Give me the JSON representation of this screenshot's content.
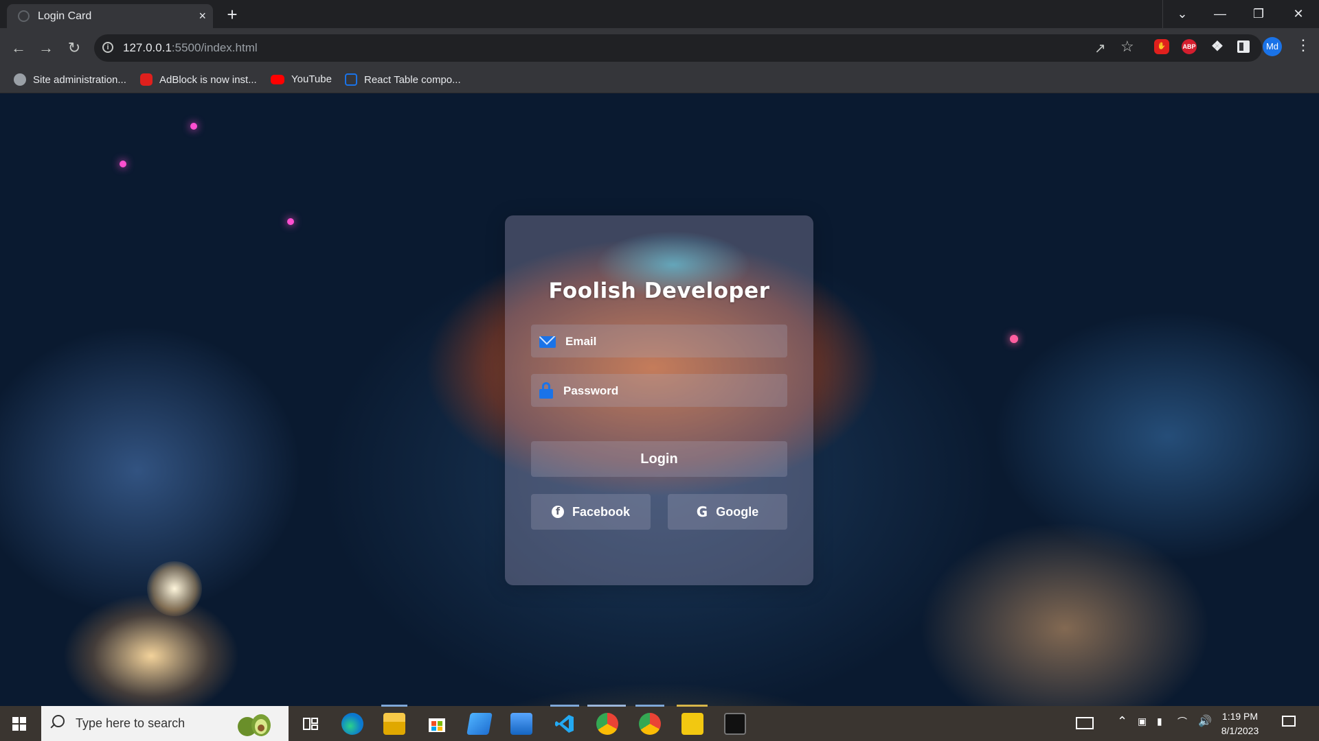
{
  "browser": {
    "tab_title": "Login Card",
    "tab_close": "×",
    "new_tab": "+",
    "url_host": "127.0.0.1",
    "url_rest": ":5500/index.html",
    "profile_initials": "Md",
    "extension_abp": "ABP",
    "bookmarks": [
      {
        "label": "Site administration..."
      },
      {
        "label": "AdBlock is now inst..."
      },
      {
        "label": "YouTube"
      },
      {
        "label": "React Table compo..."
      }
    ]
  },
  "login_card": {
    "title": "Foolish Developer",
    "email_placeholder": "Email",
    "password_placeholder": "Password",
    "login_label": "Login",
    "facebook_label": "Facebook",
    "google_label": "Google"
  },
  "taskbar": {
    "search_placeholder": "Type here to search",
    "time": "1:19 PM",
    "date": "8/1/2023",
    "pinned_apps": [
      "task-view",
      "edge",
      "file-explorer",
      "microsoft-store",
      "mail-app",
      "outlook",
      "vs-code",
      "chrome-profile",
      "chrome",
      "power-bi",
      "terminal"
    ]
  },
  "colors": {
    "accent_blue": "#1a73e8",
    "card_bg": "rgba(170,160,190,0.33)",
    "browser_frame": "#202124",
    "toolbar": "#35363a"
  }
}
